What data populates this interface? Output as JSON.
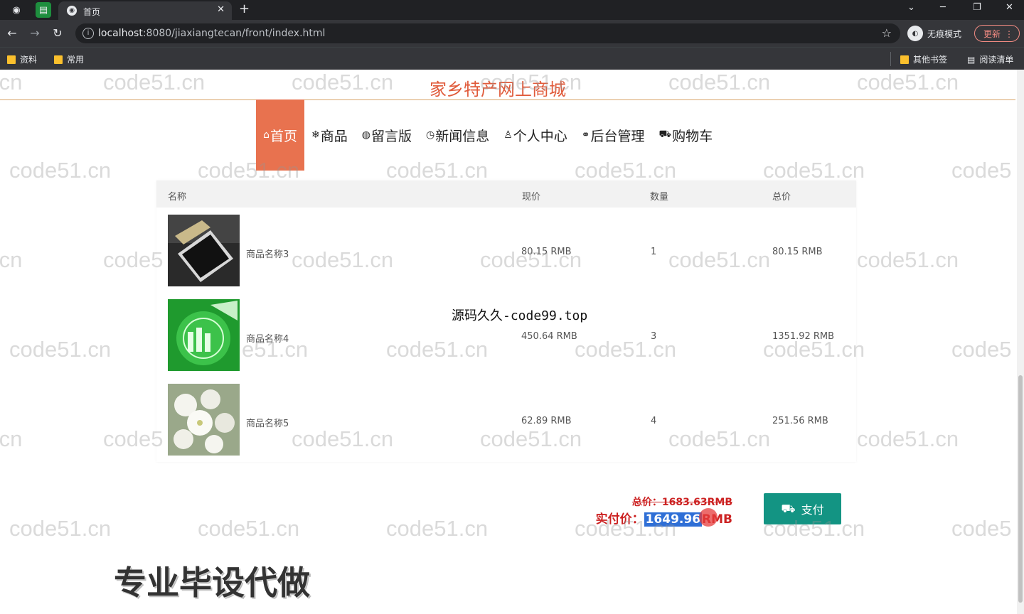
{
  "browser": {
    "tab_title": "首页",
    "url_host": "localhost",
    "url_path": ":8080/jiaxiangtecan/front/index.html",
    "incognito_label": "无痕模式",
    "update_label": "更新",
    "bookmarks": [
      "资料",
      "常用"
    ],
    "other_bookmarks": "其他书签",
    "reading_list": "阅读清单"
  },
  "site": {
    "title": "家乡特产网上商城",
    "nav": [
      {
        "icon": "⌂",
        "label": "首页",
        "active": true
      },
      {
        "icon": "❄",
        "label": "商品"
      },
      {
        "icon": "◍",
        "label": "留言版"
      },
      {
        "icon": "◷",
        "label": "新闻信息"
      },
      {
        "icon": "♙",
        "label": "个人中心"
      },
      {
        "icon": "⚭",
        "label": "后台管理"
      },
      {
        "icon": "⛟",
        "label": "购物车"
      }
    ]
  },
  "cart": {
    "headers": {
      "name": "名称",
      "price": "现价",
      "qty": "数量",
      "total": "总价"
    },
    "items": [
      {
        "name": "商品名称3",
        "price": "80.15 RMB",
        "qty": "1",
        "total": "80.15 RMB",
        "image": "phone"
      },
      {
        "name": "商品名称4",
        "price": "450.64 RMB",
        "qty": "3",
        "total": "1351.92 RMB",
        "image": "green"
      },
      {
        "name": "商品名称5",
        "price": "62.89 RMB",
        "qty": "4",
        "total": "251.56 RMB",
        "image": "flowers"
      }
    ],
    "original_total": "总价：1683.63RMB",
    "paid_label": "实付价：",
    "paid_value": "1649.96",
    "paid_unit": "RMB",
    "pay_button": "支付"
  },
  "overlays": {
    "center_note": "源码久久-code99.top",
    "big_note": "专业毕设代做",
    "watermark": "code51.cn"
  }
}
